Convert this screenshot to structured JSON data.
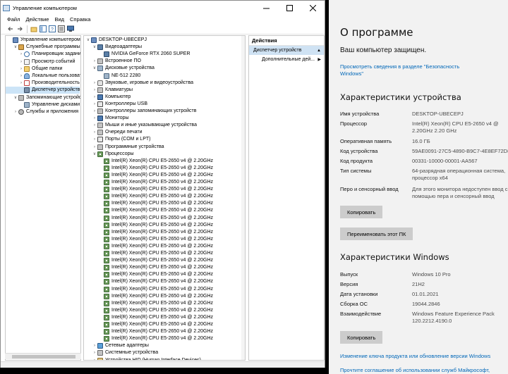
{
  "cm": {
    "title": "Управление компьютером",
    "menu": [
      "Файл",
      "Действие",
      "Вид",
      "Справка"
    ],
    "left_tree": [
      {
        "label": "Управление компьютером (л",
        "level": 0,
        "exp": "",
        "icon": "comp"
      },
      {
        "label": "Служебные программы",
        "level": 1,
        "exp": "v",
        "icon": "tool"
      },
      {
        "label": "Планировщик заданий",
        "level": 2,
        "exp": ">",
        "icon": "clock"
      },
      {
        "label": "Просмотр событий",
        "level": 2,
        "exp": ">",
        "icon": "evt"
      },
      {
        "label": "Общие папки",
        "level": 2,
        "exp": ">",
        "icon": "folder"
      },
      {
        "label": "Локальные пользоват",
        "level": 2,
        "exp": ">",
        "icon": "users"
      },
      {
        "label": "Производительность",
        "level": 2,
        "exp": ">",
        "icon": "perf"
      },
      {
        "label": "Диспетчер устройств",
        "level": 2,
        "exp": "",
        "icon": "dev",
        "selected": true
      },
      {
        "label": "Запоминающие устройств",
        "level": 1,
        "exp": "v",
        "icon": "store"
      },
      {
        "label": "Управление дисками",
        "level": 2,
        "exp": "",
        "icon": "disk"
      },
      {
        "label": "Службы и приложения",
        "level": 1,
        "exp": ">",
        "icon": "svc"
      }
    ],
    "device_tree": [
      {
        "label": "DESKTOP-UBECEPJ",
        "level": 0,
        "exp": "v",
        "icon": "comp"
      },
      {
        "label": "Видеоадаптеры",
        "level": 1,
        "exp": "v",
        "icon": "gpu"
      },
      {
        "label": "NVIDIA GeForce RTX 2060 SUPER",
        "level": 2,
        "exp": "",
        "icon": "gpu"
      },
      {
        "label": "Встроенное ПО",
        "level": 1,
        "exp": ">",
        "icon": "hw"
      },
      {
        "label": "Дисковые устройства",
        "level": 1,
        "exp": "v",
        "icon": "disk"
      },
      {
        "label": "NE-512 2280",
        "level": 2,
        "exp": "",
        "icon": "disk"
      },
      {
        "label": "Звуковые, игровые и видеоустройства",
        "level": 1,
        "exp": ">",
        "icon": "aud"
      },
      {
        "label": "Клавиатуры",
        "level": 1,
        "exp": ">",
        "icon": "hw"
      },
      {
        "label": "Компьютер",
        "level": 1,
        "exp": ">",
        "icon": "mon"
      },
      {
        "label": "Контроллеры USB",
        "level": 1,
        "exp": ">",
        "icon": "usb"
      },
      {
        "label": "Контроллеры запоминающих устройств",
        "level": 1,
        "exp": ">",
        "icon": "store"
      },
      {
        "label": "Мониторы",
        "level": 1,
        "exp": ">",
        "icon": "mon"
      },
      {
        "label": "Мыши и иные указывающие устройства",
        "level": 1,
        "exp": ">",
        "icon": "hw"
      },
      {
        "label": "Очереди печати",
        "level": 1,
        "exp": ">",
        "icon": "hw"
      },
      {
        "label": "Порты (COM и LPT)",
        "level": 1,
        "exp": ">",
        "icon": "usb"
      },
      {
        "label": "Программные устройства",
        "level": 1,
        "exp": ">",
        "icon": "hw"
      },
      {
        "label": "Процессоры",
        "level": 1,
        "exp": "v",
        "icon": "cpu"
      },
      {
        "label": "Intel(R) Xeon(R) CPU E5-2650 v4 @ 2.20GHz",
        "level": 2,
        "exp": "",
        "icon": "cpu"
      },
      {
        "label": "Intel(R) Xeon(R) CPU E5-2650 v4 @ 2.20GHz",
        "level": 2,
        "exp": "",
        "icon": "cpu"
      },
      {
        "label": "Intel(R) Xeon(R) CPU E5-2650 v4 @ 2.20GHz",
        "level": 2,
        "exp": "",
        "icon": "cpu"
      },
      {
        "label": "Intel(R) Xeon(R) CPU E5-2650 v4 @ 2.20GHz",
        "level": 2,
        "exp": "",
        "icon": "cpu"
      },
      {
        "label": "Intel(R) Xeon(R) CPU E5-2650 v4 @ 2.20GHz",
        "level": 2,
        "exp": "",
        "icon": "cpu"
      },
      {
        "label": "Intel(R) Xeon(R) CPU E5-2650 v4 @ 2.20GHz",
        "level": 2,
        "exp": "",
        "icon": "cpu"
      },
      {
        "label": "Intel(R) Xeon(R) CPU E5-2650 v4 @ 2.20GHz",
        "level": 2,
        "exp": "",
        "icon": "cpu"
      },
      {
        "label": "Intel(R) Xeon(R) CPU E5-2650 v4 @ 2.20GHz",
        "level": 2,
        "exp": "",
        "icon": "cpu"
      },
      {
        "label": "Intel(R) Xeon(R) CPU E5-2650 v4 @ 2.20GHz",
        "level": 2,
        "exp": "",
        "icon": "cpu"
      },
      {
        "label": "Intel(R) Xeon(R) CPU E5-2650 v4 @ 2.20GHz",
        "level": 2,
        "exp": "",
        "icon": "cpu"
      },
      {
        "label": "Intel(R) Xeon(R) CPU E5-2650 v4 @ 2.20GHz",
        "level": 2,
        "exp": "",
        "icon": "cpu"
      },
      {
        "label": "Intel(R) Xeon(R) CPU E5-2650 v4 @ 2.20GHz",
        "level": 2,
        "exp": "",
        "icon": "cpu"
      },
      {
        "label": "Intel(R) Xeon(R) CPU E5-2650 v4 @ 2.20GHz",
        "level": 2,
        "exp": "",
        "icon": "cpu"
      },
      {
        "label": "Intel(R) Xeon(R) CPU E5-2650 v4 @ 2.20GHz",
        "level": 2,
        "exp": "",
        "icon": "cpu"
      },
      {
        "label": "Intel(R) Xeon(R) CPU E5-2650 v4 @ 2.20GHz",
        "level": 2,
        "exp": "",
        "icon": "cpu"
      },
      {
        "label": "Intel(R) Xeon(R) CPU E5-2650 v4 @ 2.20GHz",
        "level": 2,
        "exp": "",
        "icon": "cpu"
      },
      {
        "label": "Intel(R) Xeon(R) CPU E5-2650 v4 @ 2.20GHz",
        "level": 2,
        "exp": "",
        "icon": "cpu"
      },
      {
        "label": "Intel(R) Xeon(R) CPU E5-2650 v4 @ 2.20GHz",
        "level": 2,
        "exp": "",
        "icon": "cpu"
      },
      {
        "label": "Intel(R) Xeon(R) CPU E5-2650 v4 @ 2.20GHz",
        "level": 2,
        "exp": "",
        "icon": "cpu"
      },
      {
        "label": "Intel(R) Xeon(R) CPU E5-2650 v4 @ 2.20GHz",
        "level": 2,
        "exp": "",
        "icon": "cpu"
      },
      {
        "label": "Intel(R) Xeon(R) CPU E5-2650 v4 @ 2.20GHz",
        "level": 2,
        "exp": "",
        "icon": "cpu"
      },
      {
        "label": "Intel(R) Xeon(R) CPU E5-2650 v4 @ 2.20GHz",
        "level": 2,
        "exp": "",
        "icon": "cpu"
      },
      {
        "label": "Intel(R) Xeon(R) CPU E5-2650 v4 @ 2.20GHz",
        "level": 2,
        "exp": "",
        "icon": "cpu"
      },
      {
        "label": "Intel(R) Xeon(R) CPU E5-2650 v4 @ 2.20GHz",
        "level": 2,
        "exp": "",
        "icon": "cpu"
      },
      {
        "label": "Intel(R) Xeon(R) CPU E5-2650 v4 @ 2.20GHz",
        "level": 2,
        "exp": "",
        "icon": "cpu"
      },
      {
        "label": "Intel(R) Xeon(R) CPU E5-2650 v4 @ 2.20GHz",
        "level": 2,
        "exp": "",
        "icon": "cpu"
      },
      {
        "label": "Сетевые адаптеры",
        "level": 1,
        "exp": ">",
        "icon": "net"
      },
      {
        "label": "Системные устройства",
        "level": 1,
        "exp": ">",
        "icon": "hw"
      },
      {
        "label": "Устройства HID (Human Interface Devices)",
        "level": 1,
        "exp": ">",
        "icon": "hid"
      }
    ],
    "actions": {
      "header": "Действия",
      "section": "Диспетчер устройств",
      "more": "Дополнительные дей..."
    }
  },
  "about": {
    "title": "О программе",
    "protected": "Ваш компьютер защищен.",
    "security_link": "Просмотреть сведения в разделе \"Безопасность Windows\"",
    "device_heading": "Характеристики устройства",
    "device_specs": [
      {
        "k": "Имя устройства",
        "v": "DESKTOP-UBECEPJ"
      },
      {
        "k": "Процессор",
        "v": "Intel(R) Xeon(R) CPU E5-2650 v4 @ 2.20GHz   2.20 GHz"
      },
      {
        "k": "Оперативная память",
        "v": "16.0 ГБ"
      },
      {
        "k": "Код устройства",
        "v": "59AE0091-27C5-4890-B9C7-4E8EF72D8"
      },
      {
        "k": "Код продукта",
        "v": "00331-10000-00001-AA567"
      },
      {
        "k": "Тип системы",
        "v": "64-разрядная операционная система, процессор x64"
      },
      {
        "k": "Перо и сенсорный ввод",
        "v": "Для этого монитора недоступен ввод с помощью пера и сенсорный ввод"
      }
    ],
    "copy_label": "Копировать",
    "rename_label": "Переименовать этот ПК",
    "windows_heading": "Характеристики Windows",
    "windows_specs": [
      {
        "k": "Выпуск",
        "v": "Windows 10 Pro"
      },
      {
        "k": "Версия",
        "v": "21H2"
      },
      {
        "k": "Дата установки",
        "v": "01.01.2021"
      },
      {
        "k": "Сборка ОС",
        "v": "19044.2846"
      },
      {
        "k": "Взаимодействие",
        "v": "Windows Feature Experience Pack 120.2212.4190.0"
      }
    ],
    "copy2_label": "Копировать",
    "link_product_key": "Изменение ключа продукта или обновление версии Windows",
    "link_agreement": "Прочтите соглашение об использовании служб Майкрософт,"
  }
}
